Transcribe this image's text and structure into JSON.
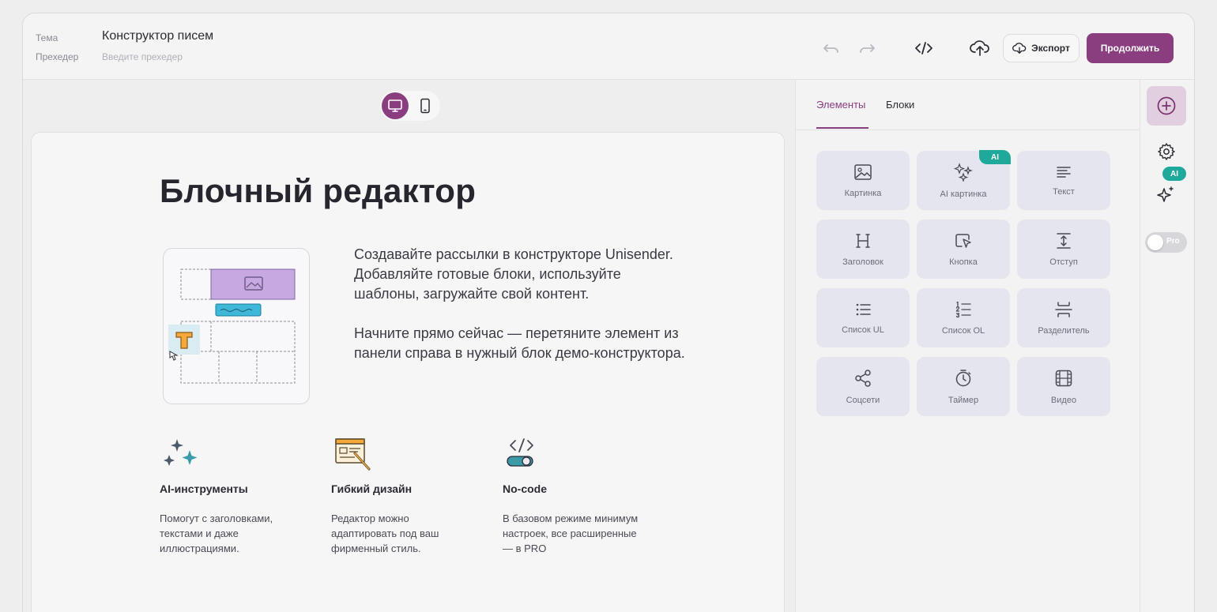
{
  "header": {
    "theme_label": "Тема",
    "theme_value": "Конструктор писем",
    "preheader_label": "Прехедер",
    "preheader_placeholder": "Введите прехедер",
    "export_label": "Экспорт",
    "continue_label": "Продолжить"
  },
  "colors": {
    "accent": "#8a3e80",
    "ai_badge": "#1fa99a"
  },
  "canvas": {
    "title": "Блочный редактор",
    "intro_p1": "Создавайте рассылки в конструкторе Unisender. Добавляйте готовые блоки, используйте шаблоны, загружайте свой контент.",
    "intro_p2": "Начните прямо сейчас — перетяните элемент из панели справа в нужный блок демо-конструктора.",
    "features": [
      {
        "title": "AI-инструменты",
        "desc": "Помогут с заголовками, текстами и даже иллюстрациями."
      },
      {
        "title": "Гибкий дизайн",
        "desc": "Редактор можно адаптировать под ваш фирменный стиль."
      },
      {
        "title": "No-code",
        "desc": "В базовом режиме минимум настроек, все расширенные — в PRO"
      }
    ]
  },
  "panel": {
    "tabs": [
      {
        "label": "Элементы",
        "active": true
      },
      {
        "label": "Блоки",
        "active": false
      }
    ],
    "elements": [
      {
        "label": "Картинка",
        "icon": "image-icon"
      },
      {
        "label": "AI картинка",
        "icon": "sparkles-icon",
        "badge": "AI"
      },
      {
        "label": "Текст",
        "icon": "text-lines-icon"
      },
      {
        "label": "Заголовок",
        "icon": "heading-icon"
      },
      {
        "label": "Кнопка",
        "icon": "cursor-button-icon"
      },
      {
        "label": "Отступ",
        "icon": "spacing-icon"
      },
      {
        "label": "Список UL",
        "icon": "bullet-list-icon"
      },
      {
        "label": "Список OL",
        "icon": "numbered-list-icon"
      },
      {
        "label": "Разделитель",
        "icon": "divider-icon"
      },
      {
        "label": "Соцсети",
        "icon": "share-icon"
      },
      {
        "label": "Таймер",
        "icon": "timer-icon"
      },
      {
        "label": "Видео",
        "icon": "video-icon"
      }
    ]
  },
  "rail": {
    "ai_badge": "AI",
    "pro_label": "Pro"
  }
}
